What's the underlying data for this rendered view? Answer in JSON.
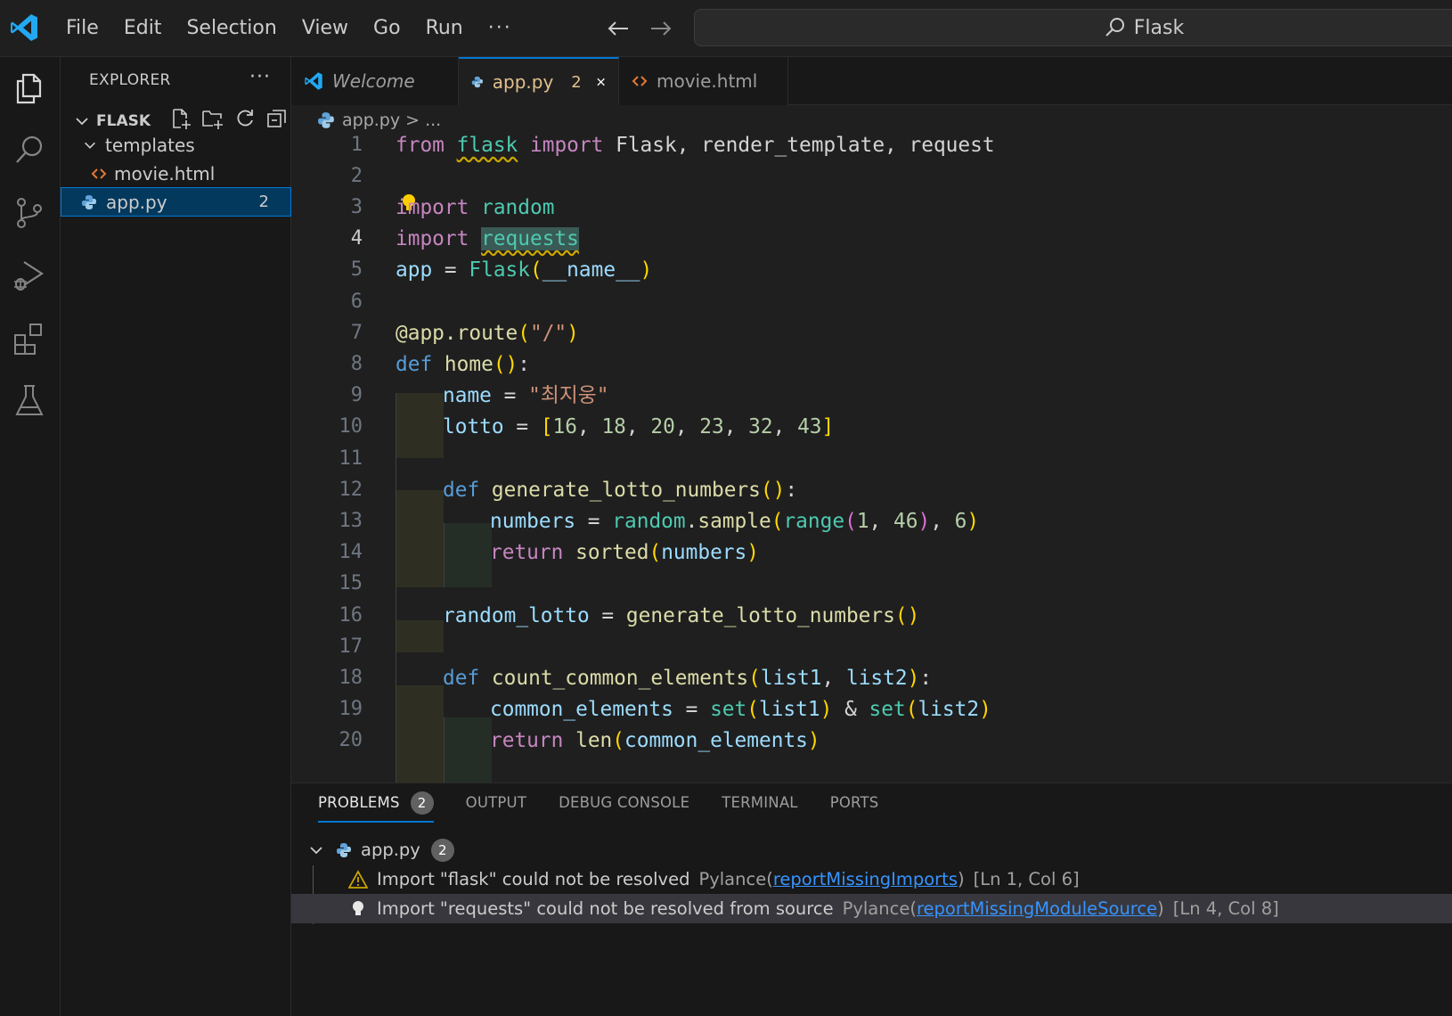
{
  "titlebar": {
    "menu": [
      "File",
      "Edit",
      "Selection",
      "View",
      "Go",
      "Run"
    ],
    "more": "···",
    "command_center": "Flask"
  },
  "explorer": {
    "header": "EXPLORER",
    "more": "···",
    "folder": "FLASK",
    "items": [
      {
        "label": "templates",
        "type": "folder"
      },
      {
        "label": "movie.html",
        "type": "html"
      },
      {
        "label": "app.py",
        "type": "python",
        "badge": "2"
      }
    ]
  },
  "tabs": [
    {
      "label": "Welcome"
    },
    {
      "label": "app.py",
      "badge": "2"
    },
    {
      "label": "movie.html"
    }
  ],
  "breadcrumb": {
    "file": "app.py",
    "rest": "> ..."
  },
  "editor": {
    "line_numbers": [
      "1",
      "2",
      "3",
      "4",
      "5",
      "6",
      "7",
      "8",
      "9",
      "10",
      "11",
      "12",
      "13",
      "14",
      "15",
      "16",
      "17",
      "18",
      "19",
      "20"
    ],
    "current_line": "4"
  },
  "code": {
    "l1": {
      "from": "from",
      "flask": "flask",
      "import": "import",
      "rest": "Flask, render_template, request"
    },
    "l3": {
      "import": "import",
      "mod": "random"
    },
    "l4": {
      "import": "import",
      "mod": "requests"
    },
    "l5": {
      "a": "app",
      "b": " = ",
      "c": "Flask",
      "d": "(",
      "e": "__name__",
      "f": ")"
    },
    "l7": {
      "a": "@app.route",
      "b": "(",
      "c": "\"/\"",
      "d": ")"
    },
    "l8": {
      "a": "def",
      "b": "home",
      "c": "()",
      "d": ":"
    },
    "l9": {
      "a": "name",
      "b": " = ",
      "c": "\"최지웅\""
    },
    "l10": {
      "a": "lotto",
      "b": " = ",
      "c": "[",
      "d": "16",
      "e": ", ",
      "f": "18",
      "g": "20",
      "h": "23",
      "i": "32",
      "j": "43",
      "k": "]"
    },
    "l12": {
      "a": "def",
      "b": "generate_lotto_numbers",
      "c": "()",
      "d": ":"
    },
    "l13": {
      "a": "numbers",
      "b": " = ",
      "c": "random",
      "d": ".",
      "e": "sample",
      "f": "(",
      "g": "range",
      "h": "(",
      "i": "1",
      "j": ", ",
      "k": "46",
      "l": ")",
      "m": ", ",
      "n": "6",
      "o": ")"
    },
    "l14": {
      "a": "return",
      "b": "sorted",
      "c": "(",
      "d": "numbers",
      "e": ")"
    },
    "l16": {
      "a": "random_lotto",
      "b": " = ",
      "c": "generate_lotto_numbers",
      "d": "()"
    },
    "l18": {
      "a": "def",
      "b": "count_common_elements",
      "c": "(",
      "d": "list1",
      "e": ", ",
      "f": "list2",
      "g": ")",
      "h": ":"
    },
    "l19": {
      "a": "common_elements",
      "b": " = ",
      "c": "set",
      "d": "(",
      "e": "list1",
      "f": ")",
      "g": " & ",
      "h": "set",
      "i": "(",
      "j": "list2",
      "k": ")"
    },
    "l20": {
      "a": "return",
      "b": "len",
      "c": "(",
      "d": "common_elements",
      "e": ")"
    }
  },
  "panel": {
    "tabs": [
      {
        "label": "PROBLEMS",
        "badge": "2"
      },
      {
        "label": "OUTPUT"
      },
      {
        "label": "DEBUG CONSOLE"
      },
      {
        "label": "TERMINAL"
      },
      {
        "label": "PORTS"
      }
    ],
    "file": {
      "label": "app.py",
      "badge": "2"
    },
    "problems": [
      {
        "severity": "warning",
        "message": "Import \"flask\" could not be resolved",
        "source": "Pylance",
        "code": "reportMissingImports",
        "location": "[Ln 1, Col 6]"
      },
      {
        "severity": "info",
        "message": "Import \"requests\" could not be resolved from source",
        "source": "Pylance",
        "code": "reportMissingModuleSource",
        "location": "[Ln 4, Col 8]"
      }
    ]
  },
  "colors": {
    "accent": "#0078d4",
    "keyword": "#c586c0",
    "module": "#4ec9b0",
    "warning": "#cca700"
  }
}
